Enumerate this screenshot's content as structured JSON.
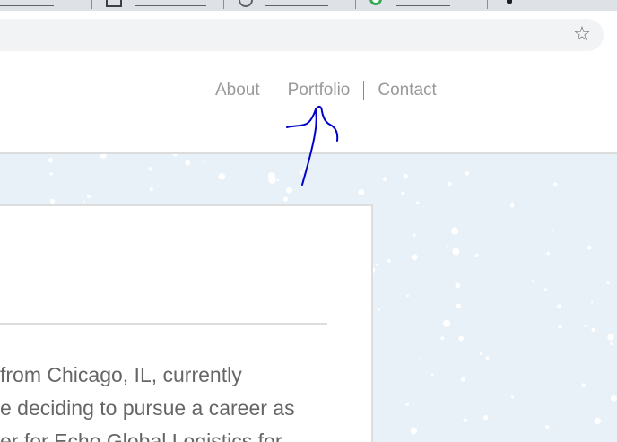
{
  "browser": {
    "bookmark_icon": "star-outline-icon",
    "tab_icons": [
      "document-icon",
      "google-icon",
      "green-circle-icon"
    ]
  },
  "nav": {
    "items": [
      {
        "label": "About"
      },
      {
        "label": "Portfolio"
      },
      {
        "label": "Contact"
      }
    ]
  },
  "intro": {
    "lines": [
      "from Chicago, IL, currently",
      "e deciding to pursue a career as",
      "er for Echo Global Logistics for"
    ]
  },
  "annotation": {
    "type": "hand-drawn-arrow",
    "color": "#0000cc",
    "points_to": "Portfolio"
  },
  "colors": {
    "nav_text": "#999999",
    "body_text": "#666666",
    "snow_background": "#e8f1f8",
    "annotation": "#0000cc"
  }
}
